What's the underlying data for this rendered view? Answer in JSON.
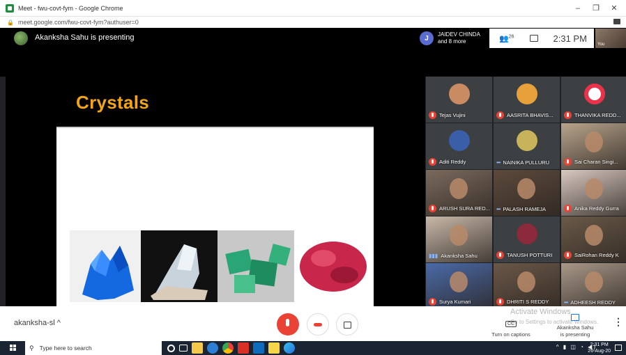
{
  "window": {
    "title": "Meet - fwu-covt-fym - Google Chrome",
    "controls": [
      "–",
      "❐",
      "✕"
    ]
  },
  "address_bar": {
    "url": "meet.google.com/fwu-covt-fym?authuser=0"
  },
  "meet": {
    "presenting_banner": "Akanksha Sahu is presenting",
    "participants_chip": {
      "initial": "J",
      "line1": "JAIDEV CHINDA",
      "line2": "and 8 more"
    },
    "people_count": "26",
    "time": "2:31 PM",
    "self_view_label": "You"
  },
  "slide": {
    "title": "Crystals"
  },
  "participants": [
    {
      "name": "Tejas Vujini",
      "status": "muted",
      "kind": "avatar",
      "color": "#c98b62"
    },
    {
      "name": "AASRITA BHAVIS...",
      "status": "muted",
      "kind": "avatar",
      "color": "#e8a03a"
    },
    {
      "name": "THANVIKA REDD...",
      "status": "muted",
      "kind": "avatar",
      "color": "#ffffff"
    },
    {
      "name": "Aditi Reddy",
      "status": "muted",
      "kind": "avatar",
      "color": "#3a5fa8"
    },
    {
      "name": "NAINIKA PULLURU",
      "status": "dots",
      "kind": "avatar",
      "color": "#c7b45a"
    },
    {
      "name": "Sai Charan Singi...",
      "status": "muted",
      "kind": "video",
      "color": "#b8a48c"
    },
    {
      "name": "ARUSH SURA RED...",
      "status": "muted",
      "kind": "video",
      "color": "#7a6a5c"
    },
    {
      "name": "PALASH RAMEJA",
      "status": "dots",
      "kind": "video",
      "color": "#5c4a3c"
    },
    {
      "name": "Anika Reddy Gurra",
      "status": "muted",
      "kind": "video",
      "color": "#d8c8c0"
    },
    {
      "name": "Akanksha Sahu",
      "status": "speaking",
      "kind": "video",
      "color": "#c8b8a8"
    },
    {
      "name": "TANUSH POTTURI",
      "status": "muted",
      "kind": "avatar",
      "color": "#8a2a3a"
    },
    {
      "name": "SaiRohan Reddy K",
      "status": "muted",
      "kind": "video",
      "color": "#6a5a48"
    },
    {
      "name": "Surya Kumari",
      "status": "muted",
      "kind": "video",
      "color": "#4a6aa8"
    },
    {
      "name": "DHRITI S REDDY",
      "status": "muted",
      "kind": "video",
      "color": "#6a5848"
    },
    {
      "name": "ADHEESH REDDY",
      "status": "dots",
      "kind": "video",
      "color": "#a89888"
    }
  ],
  "controls": {
    "user": "akanksha-sl",
    "captions_label": "Turn on captions",
    "presenting_line1": "Akanksha Sahu",
    "presenting_line2": "is presenting",
    "watermark_title": "Activate Windows",
    "watermark_sub": "Go to Settings to activate Windows."
  },
  "taskbar": {
    "search_placeholder": "Type here to search",
    "clock_time": "2:31 PM",
    "clock_date": "26-Aug-20"
  }
}
